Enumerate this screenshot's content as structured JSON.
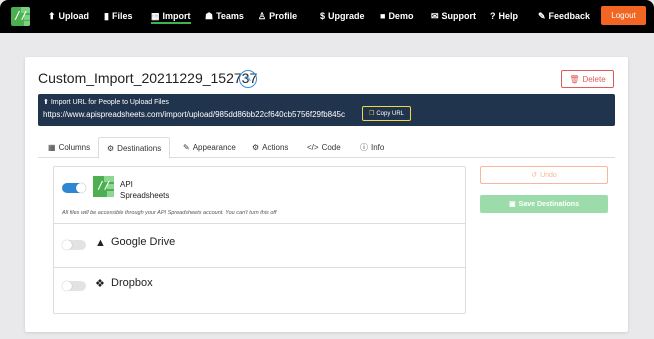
{
  "nav": {
    "items": [
      {
        "icon": "upload-icon",
        "glyph": "⬆",
        "label": "Upload"
      },
      {
        "icon": "files-icon",
        "glyph": "▮",
        "label": "Files"
      },
      {
        "icon": "import-icon",
        "glyph": "▦",
        "label": "Import"
      },
      {
        "icon": "teams-icon",
        "glyph": "☗",
        "label": "Teams"
      },
      {
        "icon": "profile-icon",
        "glyph": "♙",
        "label": "Profile"
      },
      {
        "icon": "dollar-icon",
        "glyph": "$",
        "label": "Upgrade"
      },
      {
        "icon": "video-icon",
        "glyph": "■",
        "label": "Demo"
      },
      {
        "icon": "mail-icon",
        "glyph": "✉",
        "label": "Support"
      },
      {
        "icon": "help-icon",
        "glyph": "?",
        "label": "Help"
      },
      {
        "icon": "feedback-icon",
        "glyph": "✎",
        "label": "Feedback"
      }
    ],
    "active": "Import",
    "logout_label": "Logout"
  },
  "page": {
    "title": "Custom_Import_20211229_152737",
    "edit_icon": "pencil-icon",
    "delete_label": "Delete"
  },
  "urlbar": {
    "label": "Import URL for People to Upload Files",
    "url": "https://www.apispreadsheets.com/import/upload/985dd86bb22cf640cb5756f29fb845c",
    "copy_label": "Copy URL"
  },
  "tabs": [
    {
      "icon": "table-icon",
      "glyph": "▦",
      "label": "Columns"
    },
    {
      "icon": "destinations-icon",
      "glyph": "⚙",
      "label": "Destinations"
    },
    {
      "icon": "brush-icon",
      "glyph": "✎",
      "label": "Appearance"
    },
    {
      "icon": "gears-icon",
      "glyph": "⚙",
      "label": "Actions"
    },
    {
      "icon": "code-icon",
      "glyph": "</>",
      "label": "Code"
    },
    {
      "icon": "info-icon",
      "glyph": "ⓘ",
      "label": "Info"
    }
  ],
  "active_tab": "Destinations",
  "destinations": {
    "api": {
      "name": "API Spreadsheets",
      "enabled": true,
      "note": "All files will be accessible through your API Spreadsheets account. You can't turn this off"
    },
    "google_drive": {
      "name": "Google Drive",
      "enabled": false
    },
    "dropbox": {
      "name": "Dropbox",
      "enabled": false
    }
  },
  "actions": {
    "undo_label": "Undo",
    "save_label": "Save Destinations"
  },
  "colors": {
    "nav_bg": "#000000",
    "logout": "#f26522",
    "urlbar": "#21344e",
    "toggle_on": "#2f86d1",
    "save": "#9bdcaa",
    "delete": "#e05a5a"
  }
}
